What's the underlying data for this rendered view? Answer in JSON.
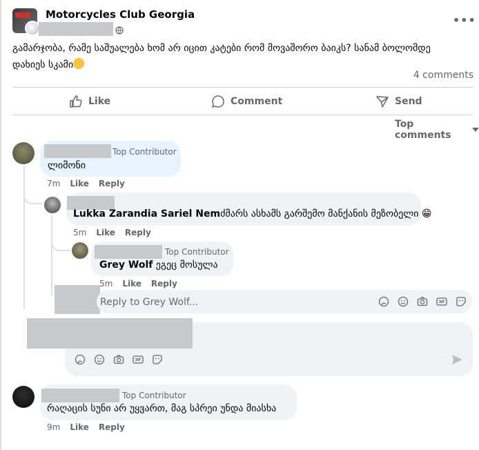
{
  "post": {
    "group_name": "Motorcycles Club Georgia",
    "text_line1": "გამარჯობა, რამე საშუალება ხომ არ იცით კატები რომ მოვაშორო ბაიკს? სანამ ბოლომდე",
    "text_line2": "დახიეს სკამი",
    "comments_count": "4 comments"
  },
  "actions": {
    "like": "Like",
    "comment": "Comment",
    "send": "Send"
  },
  "sort": {
    "label": "Top comments"
  },
  "comments": [
    {
      "badge": "Top Contributor",
      "text": "ლიმონი",
      "time": "7m",
      "like": "Like",
      "reply": "Reply"
    },
    {
      "mention": "Lukka Zarandia Sariel Nem",
      "text": "ძმარს ასხამს გარშემო მანქანის მეზობელი 😁",
      "time": "5m",
      "like": "Like",
      "reply": "Reply"
    },
    {
      "badge": "Top Contributor",
      "mention": "Grey Wolf",
      "text": " ეგეც მოსულა",
      "time": "5m",
      "like": "Like",
      "reply": "Reply"
    },
    {
      "badge": "Top Contributor",
      "text": "რაღაცის სუნი არ უყვართ, მაგ სპრეი უნდა მიასხა",
      "time": "9m",
      "like": "Like",
      "reply": "Reply"
    }
  ],
  "reply_input": {
    "placeholder": "Reply to Grey Wolf..."
  },
  "colors": {
    "accent_blue": "#e7f3ff",
    "bubble_gray": "#f0f2f5",
    "muted_text": "#65676b",
    "redaction": "#c8c9cb"
  }
}
